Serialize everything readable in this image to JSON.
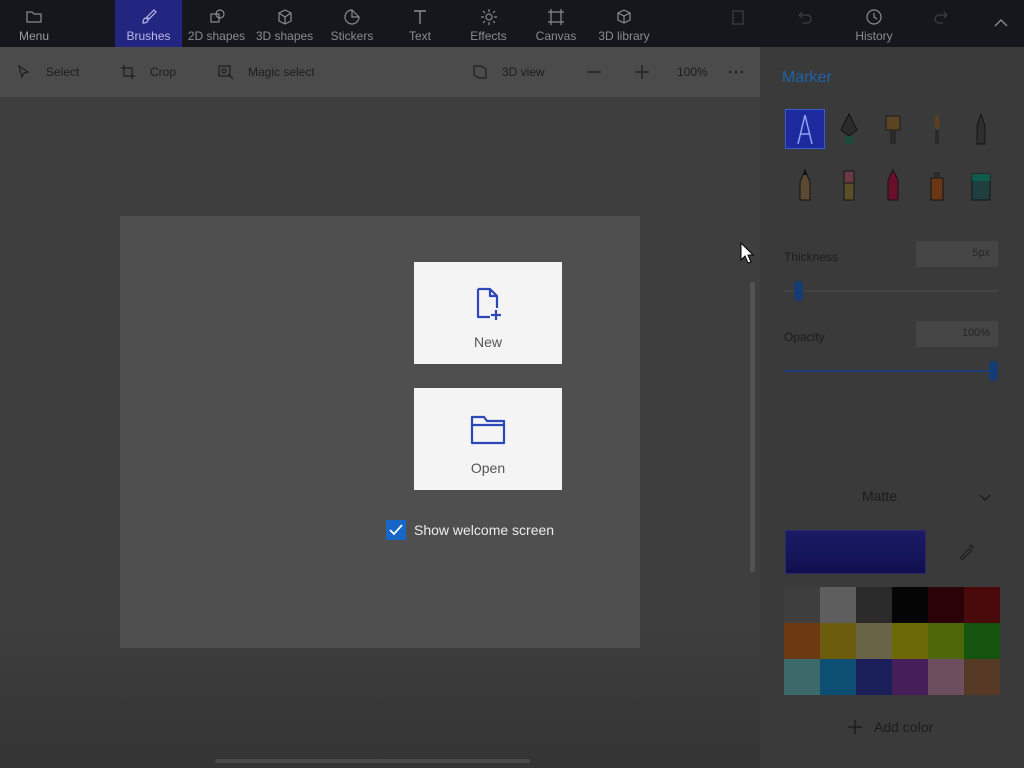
{
  "toolbar": {
    "menu": "Menu",
    "tabs": [
      {
        "label": "Brushes",
        "icon": "brush-icon"
      },
      {
        "label": "2D shapes",
        "icon": "shapes-2d-icon"
      },
      {
        "label": "3D shapes",
        "icon": "cube-icon"
      },
      {
        "label": "Stickers",
        "icon": "sticker-icon"
      },
      {
        "label": "Text",
        "icon": "text-icon"
      },
      {
        "label": "Effects",
        "icon": "effects-icon"
      },
      {
        "label": "Canvas",
        "icon": "canvas-icon"
      },
      {
        "label": "3D library",
        "icon": "library-icon"
      }
    ],
    "history": "History",
    "active_tab": "Brushes"
  },
  "subbar": {
    "select": "Select",
    "crop": "Crop",
    "magic_select": "Magic select",
    "view_3d": "3D view",
    "zoom": "100%"
  },
  "welcome": {
    "new_label": "New",
    "open_label": "Open",
    "show_welcome": "Show welcome screen",
    "show_welcome_checked": true
  },
  "panel": {
    "title": "Marker",
    "brushes": [
      "marker",
      "calligraphy-pen",
      "oil-brush",
      "watercolor",
      "pixel-pen",
      "pencil",
      "eraser",
      "crayon",
      "spray-can",
      "fill"
    ],
    "thickness_label": "Thickness",
    "thickness_value": "5px",
    "thickness_fraction": 0.05,
    "opacity_label": "Opacity",
    "opacity_value": "100%",
    "opacity_fraction": 1.0,
    "finish": "Matte",
    "current_color": "#1b1b66",
    "palette": [
      "#3e3e3e",
      "#5e5e5e",
      "#2a2a2a",
      "#050505",
      "#2b0208",
      "#4a0a0b",
      "#6c3913",
      "#6b5c0e",
      "#6a6447",
      "#6b6a07",
      "#4f6609",
      "#14540f",
      "#3c6a6a",
      "#0c4f72",
      "#1a1f5a",
      "#461e5a",
      "#6c4e5e",
      "#563a26"
    ],
    "add_color": "Add color"
  },
  "colors": {
    "accent": "#232680",
    "checkbox": "#1566c7"
  }
}
